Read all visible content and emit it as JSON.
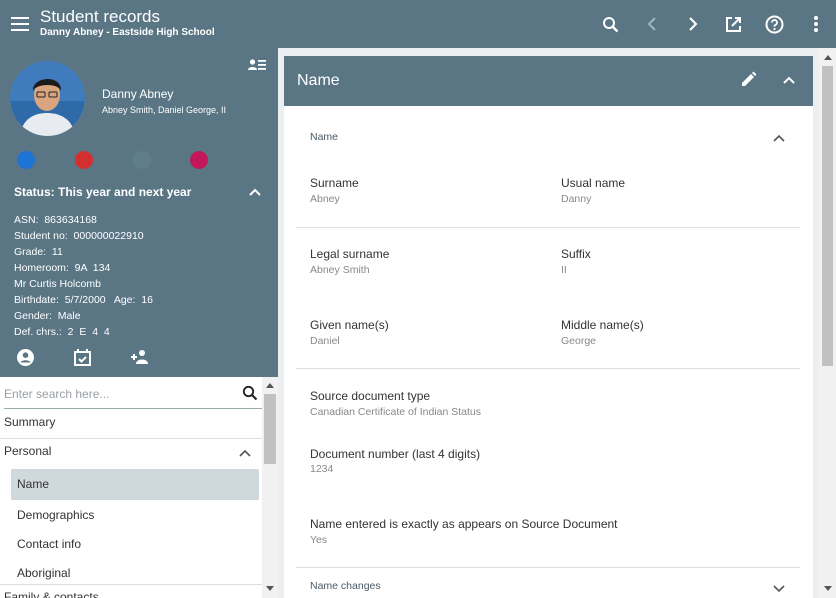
{
  "appbar": {
    "title": "Student records",
    "subtitle": "Danny Abney - Eastside High School",
    "actions": [
      "search-icon",
      "chevron-left-icon",
      "chevron-right-icon",
      "open-in-new-icon",
      "help-icon",
      "more-vert-icon"
    ]
  },
  "profile": {
    "name": "Danny Abney",
    "alias": "Abney Smith, Daniel George, II",
    "alert_colors": [
      "#1e74d6",
      "#d32f2f",
      "#607d8b",
      "#c2185b"
    ],
    "status": "Status: This year and next year",
    "info": [
      "ASN:  863634168",
      "Student no:  000000022910",
      "Grade:  11",
      "Homeroom:  9A  134",
      "Mr Curtis Holcomb",
      "Birthdate:  5/7/2000   Age:  16",
      "Gender:  Male",
      "Def. chrs.:  2  E  4  4"
    ]
  },
  "nav": {
    "search_placeholder": "Enter search here...",
    "summary": "Summary",
    "personal": "Personal",
    "sub_items": [
      "Name",
      "Demographics",
      "Contact info",
      "Aboriginal"
    ],
    "family": "Family & contacts"
  },
  "main": {
    "title": "Name",
    "section_name": "Name",
    "surname_label": "Surname",
    "surname_value": "Abney",
    "usual_label": "Usual name",
    "usual_value": "Danny",
    "legal_label": "Legal surname",
    "legal_value": "Abney Smith",
    "suffix_label": "Suffix",
    "suffix_value": "II",
    "given_label": "Given name(s)",
    "given_value": "Daniel",
    "middle_label": "Middle name(s)",
    "middle_value": "George",
    "source_label": "Source document type",
    "source_value": "Canadian Certificate of Indian Status",
    "docnum_label": "Document number (last 4 digits)",
    "docnum_value": "1234",
    "exact_label": "Name entered is exactly as appears on Source Document",
    "exact_value": "Yes",
    "section_changes": "Name changes"
  }
}
